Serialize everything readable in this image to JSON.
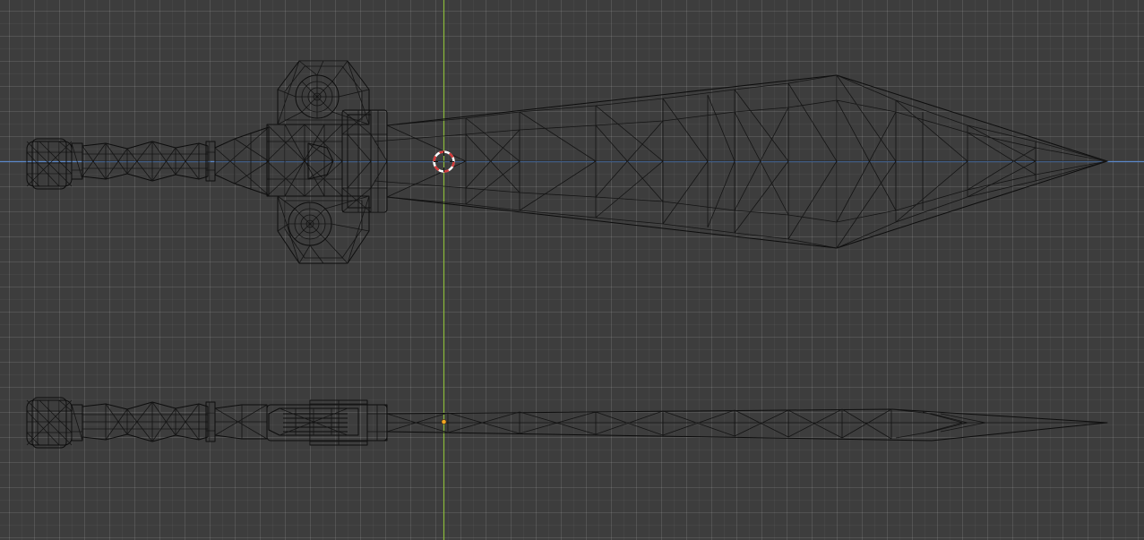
{
  "viewport": {
    "mode": "wireframe",
    "view": "orthographic",
    "grid_visible": true
  },
  "colors": {
    "background": "#3d3d3d",
    "grid": "#4c4c4c",
    "wire": "#0d0d0d",
    "x_axis": "#5b87c8",
    "y_axis": "#8bba3a",
    "cursor_red": "#d33a3a",
    "cursor_white": "#ffffff",
    "origin": "#f5a623"
  },
  "objects": [
    {
      "name_icon": "dagger-front-view-icon"
    },
    {
      "name_icon": "dagger-side-view-icon"
    }
  ],
  "icons": {
    "cursor": "3d-cursor-icon",
    "origin": "object-origin-icon"
  }
}
